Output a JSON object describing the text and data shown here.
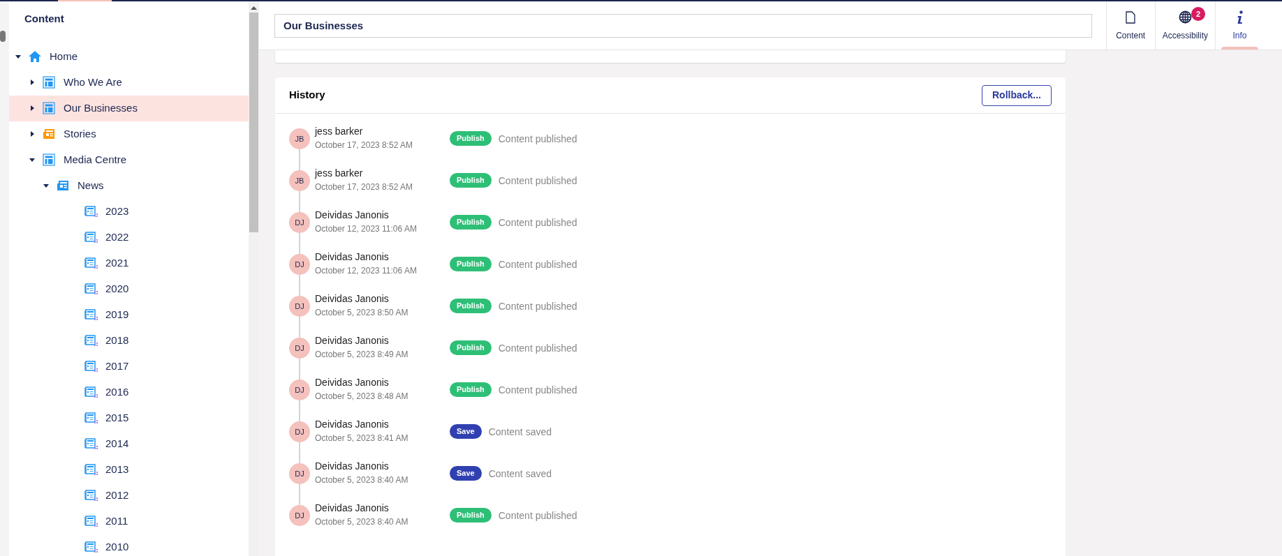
{
  "sidebar": {
    "title": "Content",
    "tree": [
      {
        "label": "Home",
        "kind": "home",
        "expanded": true,
        "selected": false,
        "children": [
          {
            "label": "Who We Are",
            "kind": "page",
            "expanded": false,
            "selected": false
          },
          {
            "label": "Our Businesses",
            "kind": "page",
            "expanded": false,
            "selected": true
          },
          {
            "label": "Stories",
            "kind": "stories",
            "expanded": false,
            "selected": false
          },
          {
            "label": "Media Centre",
            "kind": "page",
            "expanded": true,
            "selected": false,
            "children": [
              {
                "label": "News",
                "kind": "news",
                "expanded": true,
                "selected": false,
                "children": [
                  {
                    "label": "2023",
                    "kind": "year",
                    "selected": false
                  },
                  {
                    "label": "2022",
                    "kind": "year",
                    "selected": false
                  },
                  {
                    "label": "2021",
                    "kind": "year",
                    "selected": false
                  },
                  {
                    "label": "2020",
                    "kind": "year",
                    "selected": false
                  },
                  {
                    "label": "2019",
                    "kind": "year",
                    "selected": false
                  },
                  {
                    "label": "2018",
                    "kind": "year",
                    "selected": false
                  },
                  {
                    "label": "2017",
                    "kind": "year",
                    "selected": false
                  },
                  {
                    "label": "2016",
                    "kind": "year",
                    "selected": false
                  },
                  {
                    "label": "2015",
                    "kind": "year",
                    "selected": false
                  },
                  {
                    "label": "2014",
                    "kind": "year",
                    "selected": false
                  },
                  {
                    "label": "2013",
                    "kind": "year",
                    "selected": false
                  },
                  {
                    "label": "2012",
                    "kind": "year",
                    "selected": false
                  },
                  {
                    "label": "2011",
                    "kind": "year",
                    "selected": false
                  },
                  {
                    "label": "2010",
                    "kind": "year",
                    "selected": false
                  }
                ]
              }
            ]
          }
        ]
      }
    ]
  },
  "header": {
    "name_field": "Our Businesses",
    "apps": [
      {
        "kind": "content",
        "label": "Content",
        "selected": false
      },
      {
        "kind": "accessibility",
        "label": "Accessibility",
        "badge": "2",
        "selected": false
      },
      {
        "kind": "info",
        "label": "Info",
        "selected": true
      }
    ]
  },
  "history": {
    "title": "History",
    "rollback_button": "Rollback...",
    "entries": [
      {
        "initials": "JB",
        "user": "jess barker",
        "date": "October 17, 2023 8:52 AM",
        "kind": "publish",
        "badge": "Publish",
        "action": "Content published"
      },
      {
        "initials": "JB",
        "user": "jess barker",
        "date": "October 17, 2023 8:52 AM",
        "kind": "publish",
        "badge": "Publish",
        "action": "Content published"
      },
      {
        "initials": "DJ",
        "user": "Deividas Janonis",
        "date": "October 12, 2023 11:06 AM",
        "kind": "publish",
        "badge": "Publish",
        "action": "Content published"
      },
      {
        "initials": "DJ",
        "user": "Deividas Janonis",
        "date": "October 12, 2023 11:06 AM",
        "kind": "publish",
        "badge": "Publish",
        "action": "Content published"
      },
      {
        "initials": "DJ",
        "user": "Deividas Janonis",
        "date": "October 5, 2023 8:50 AM",
        "kind": "publish",
        "badge": "Publish",
        "action": "Content published"
      },
      {
        "initials": "DJ",
        "user": "Deividas Janonis",
        "date": "October 5, 2023 8:49 AM",
        "kind": "publish",
        "badge": "Publish",
        "action": "Content published"
      },
      {
        "initials": "DJ",
        "user": "Deividas Janonis",
        "date": "October 5, 2023 8:48 AM",
        "kind": "publish",
        "badge": "Publish",
        "action": "Content published"
      },
      {
        "initials": "DJ",
        "user": "Deividas Janonis",
        "date": "October 5, 2023 8:41 AM",
        "kind": "save",
        "badge": "Save",
        "action": "Content saved"
      },
      {
        "initials": "DJ",
        "user": "Deividas Janonis",
        "date": "October 5, 2023 8:40 AM",
        "kind": "save",
        "badge": "Save",
        "action": "Content saved"
      },
      {
        "initials": "DJ",
        "user": "Deividas Janonis",
        "date": "October 5, 2023 8:40 AM",
        "kind": "publish",
        "badge": "Publish",
        "action": "Content published"
      }
    ]
  }
}
